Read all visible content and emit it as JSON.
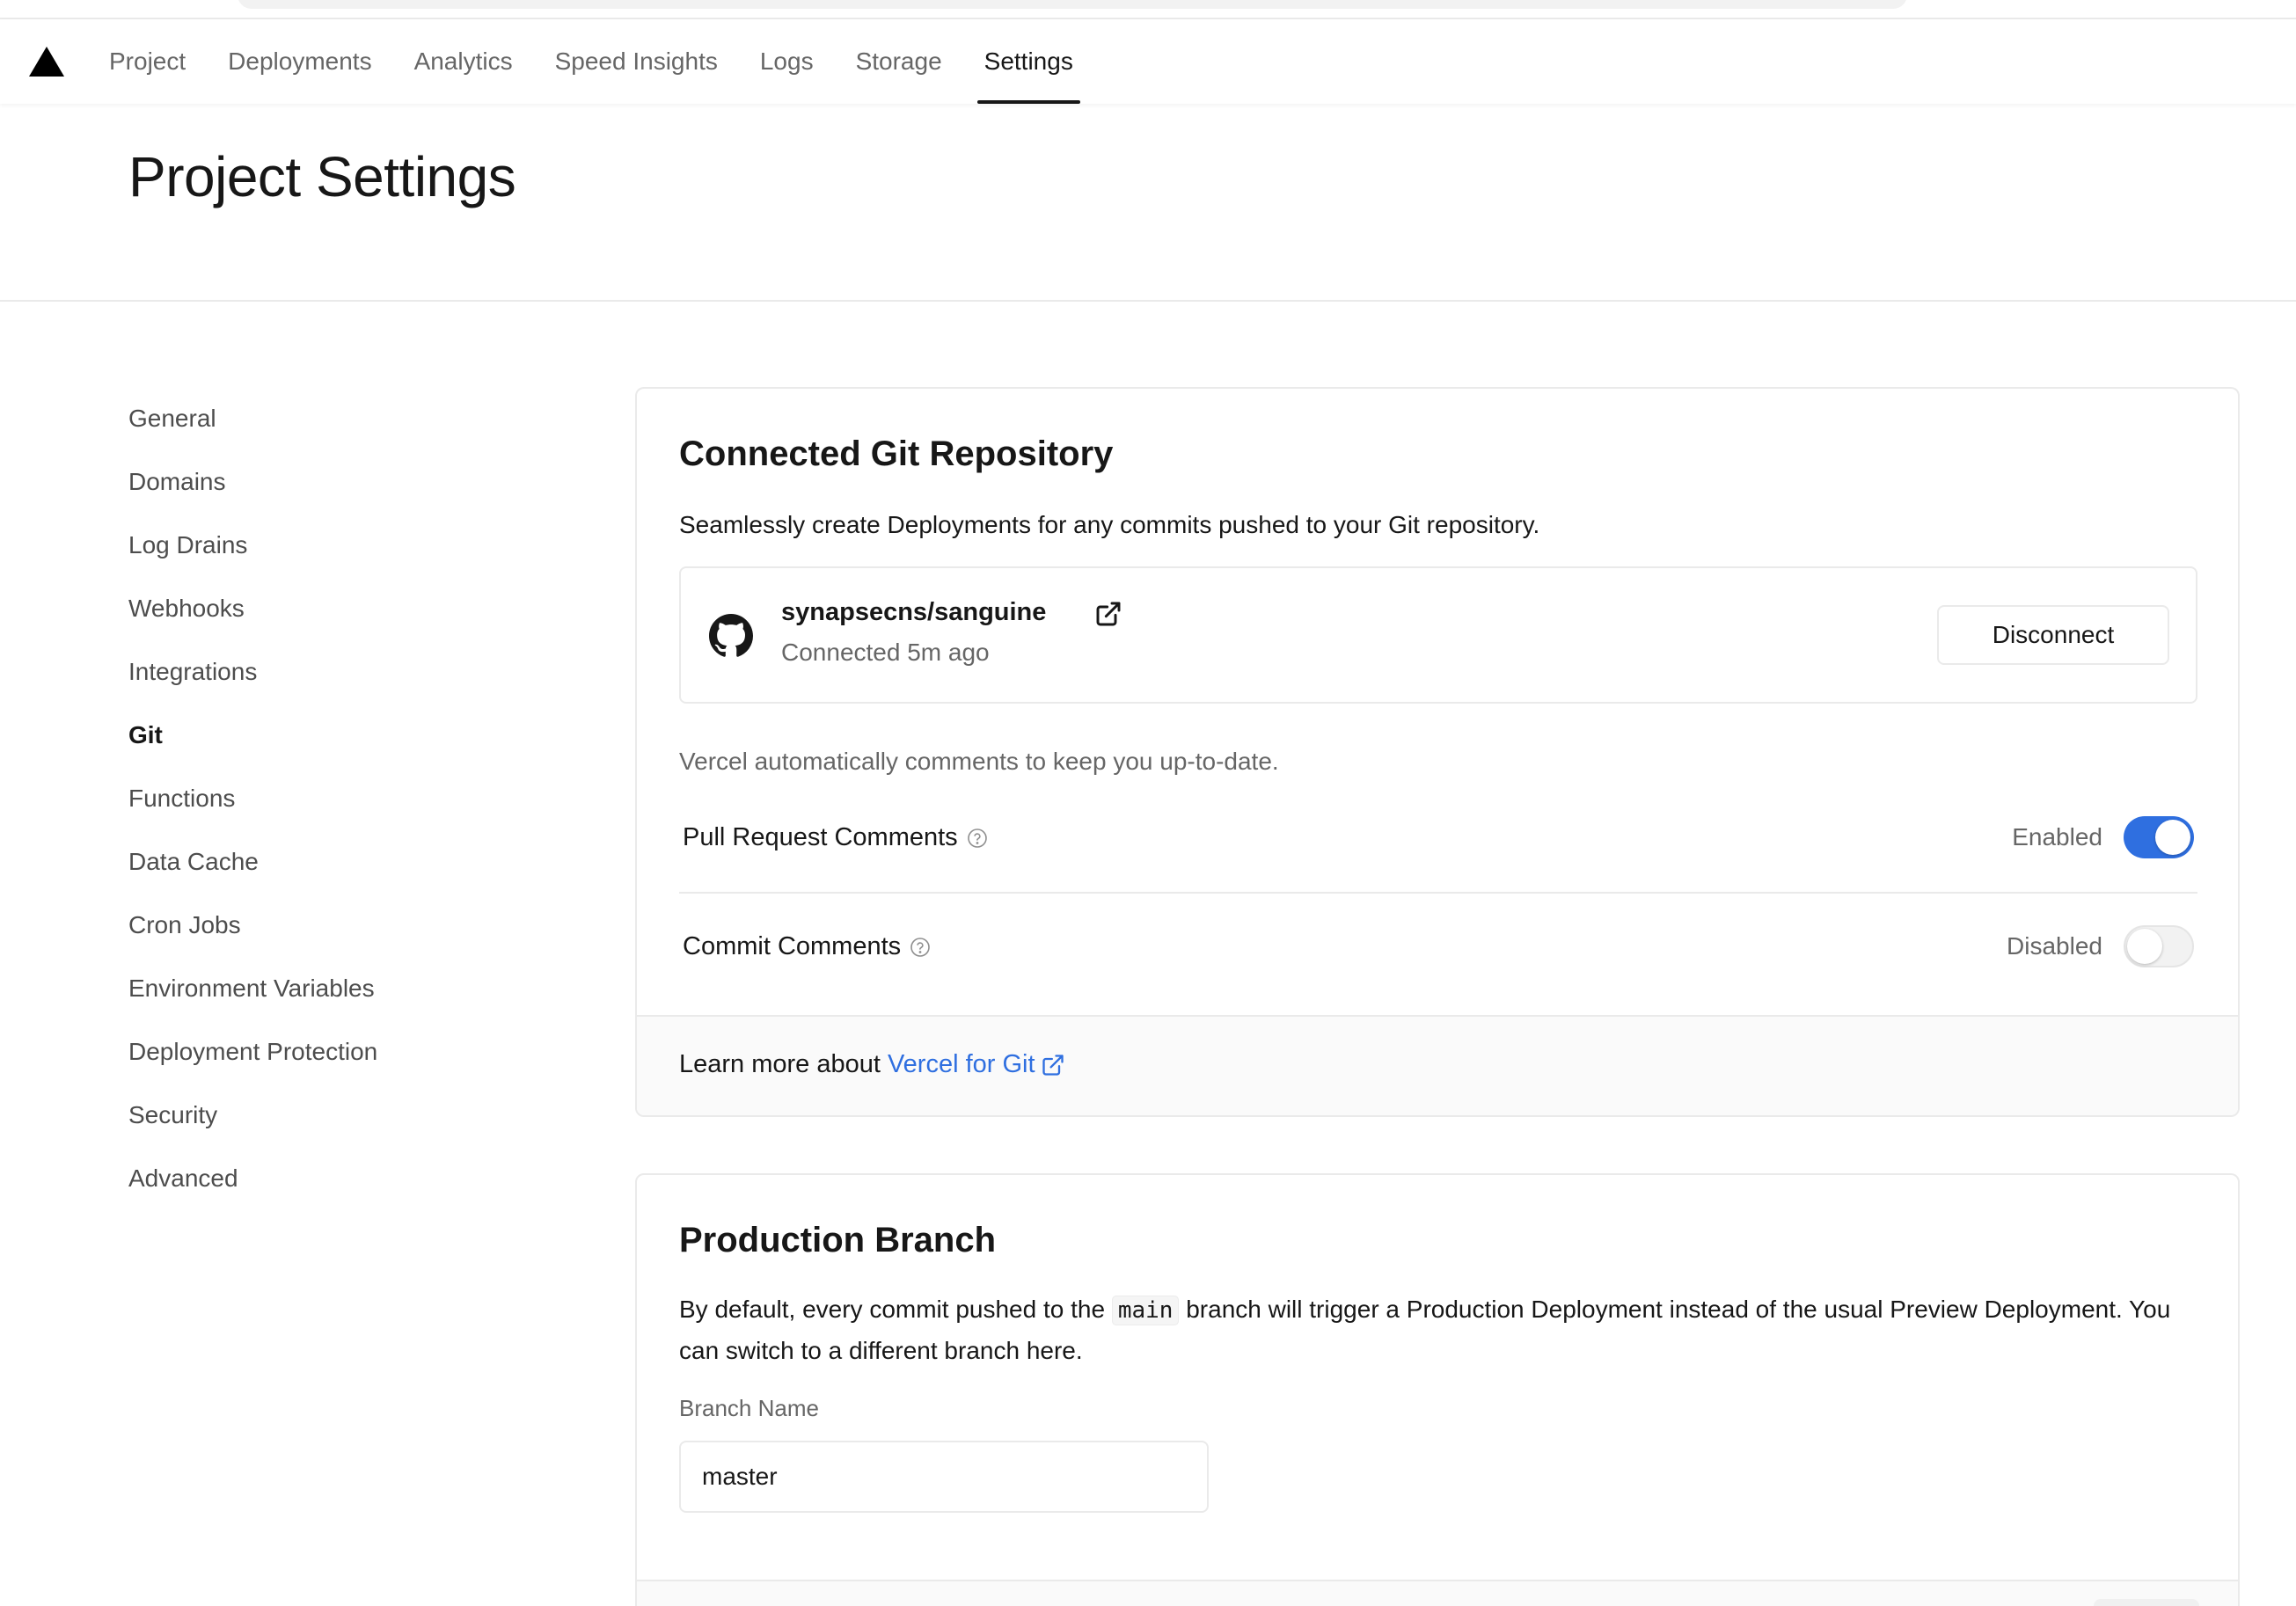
{
  "nav": {
    "tabs": [
      {
        "label": "Project"
      },
      {
        "label": "Deployments"
      },
      {
        "label": "Analytics"
      },
      {
        "label": "Speed Insights"
      },
      {
        "label": "Logs"
      },
      {
        "label": "Storage"
      },
      {
        "label": "Settings",
        "active": true
      }
    ]
  },
  "page": {
    "title": "Project Settings"
  },
  "sidebar": {
    "items": [
      {
        "label": "General"
      },
      {
        "label": "Domains"
      },
      {
        "label": "Log Drains"
      },
      {
        "label": "Webhooks"
      },
      {
        "label": "Integrations"
      },
      {
        "label": "Git",
        "active": true
      },
      {
        "label": "Functions"
      },
      {
        "label": "Data Cache"
      },
      {
        "label": "Cron Jobs"
      },
      {
        "label": "Environment Variables"
      },
      {
        "label": "Deployment Protection"
      },
      {
        "label": "Security"
      },
      {
        "label": "Advanced"
      }
    ]
  },
  "git_card": {
    "title": "Connected Git Repository",
    "description": "Seamlessly create Deployments for any commits pushed to your Git repository.",
    "repo": {
      "name": "synapsecns/sanguine",
      "status": "Connected 5m ago",
      "disconnect_label": "Disconnect"
    },
    "comments_intro": "Vercel automatically comments to keep you up-to-date.",
    "pull_request_comments": {
      "label": "Pull Request Comments",
      "status": "Enabled",
      "on": true
    },
    "commit_comments": {
      "label": "Commit Comments",
      "status": "Disabled",
      "on": false
    },
    "footer": {
      "text": "Learn more about",
      "link": "Vercel for Git"
    }
  },
  "branch_card": {
    "title": "Production Branch",
    "desc_part1": "By default, every commit pushed to the",
    "desc_code": "main",
    "desc_part2": "branch will trigger a Production Deployment instead of the usual Preview Deployment. You can switch to a different branch here.",
    "field_label": "Branch Name",
    "field_value": "master"
  },
  "colors": {
    "accent": "#2f6fe0",
    "text": "#171717",
    "muted": "#666666",
    "border": "#eaeaea"
  }
}
